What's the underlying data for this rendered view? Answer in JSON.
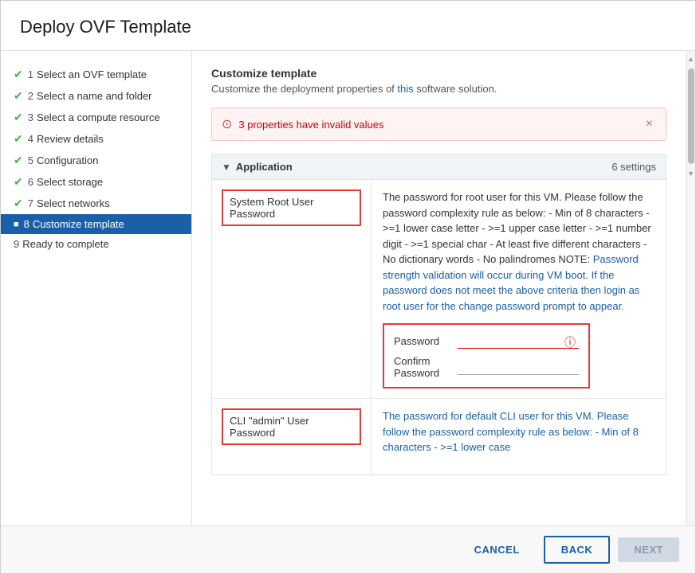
{
  "dialog": {
    "title": "Deploy OVF Template"
  },
  "sidebar": {
    "items": [
      {
        "id": "step1",
        "num": "1",
        "label": "Select an OVF template",
        "done": true,
        "active": false
      },
      {
        "id": "step2",
        "num": "2",
        "label": "Select a name and folder",
        "done": true,
        "active": false
      },
      {
        "id": "step3",
        "num": "3",
        "label": "Select a compute resource",
        "done": true,
        "active": false
      },
      {
        "id": "step4",
        "num": "4",
        "label": "Review details",
        "done": true,
        "active": false
      },
      {
        "id": "step5",
        "num": "5",
        "label": "Configuration",
        "done": true,
        "active": false
      },
      {
        "id": "step6",
        "num": "6",
        "label": "Select storage",
        "done": true,
        "active": false
      },
      {
        "id": "step7",
        "num": "7",
        "label": "Select networks",
        "done": true,
        "active": false
      },
      {
        "id": "step8",
        "num": "8",
        "label": "Customize template",
        "done": false,
        "active": true
      },
      {
        "id": "step9",
        "num": "9",
        "label": "Ready to complete",
        "done": false,
        "active": false
      }
    ]
  },
  "content": {
    "header_title": "Customize template",
    "header_desc_plain": "Customize the deployment properties of ",
    "header_desc_highlight": "this",
    "header_desc_end": " software solution.",
    "warning": {
      "icon": "⊙",
      "text": "3 properties have invalid values",
      "close_label": "×"
    },
    "section": {
      "label": "Application",
      "count": "6 settings",
      "toggle": "▼"
    },
    "row1": {
      "label": "System Root User Password",
      "description_parts": [
        {
          "text": "The password for root user for this VM. Please follow the password complexity rule as below: - Min of 8 characters - >=1 lower case letter - >=1 upper case letter - >=1 number digit - >=1 special char - At least five different characters - No dictionary words - No palindromes NOTE: Password strength validation will occur during VM boot. If the password does not meet the above criteria then login as root user for the change password prompt to appear.",
          "link": false
        }
      ],
      "password_label": "Password",
      "confirm_label": "Confirm Password"
    },
    "row2": {
      "label": "CLI \"admin\" User Password",
      "description": "The password for default CLI user for this VM. Please follow the password complexity rule as below: - Min of 8 characters - >=1 lower case"
    }
  },
  "footer": {
    "cancel_label": "CANCEL",
    "back_label": "BACK",
    "next_label": "NEXT"
  }
}
